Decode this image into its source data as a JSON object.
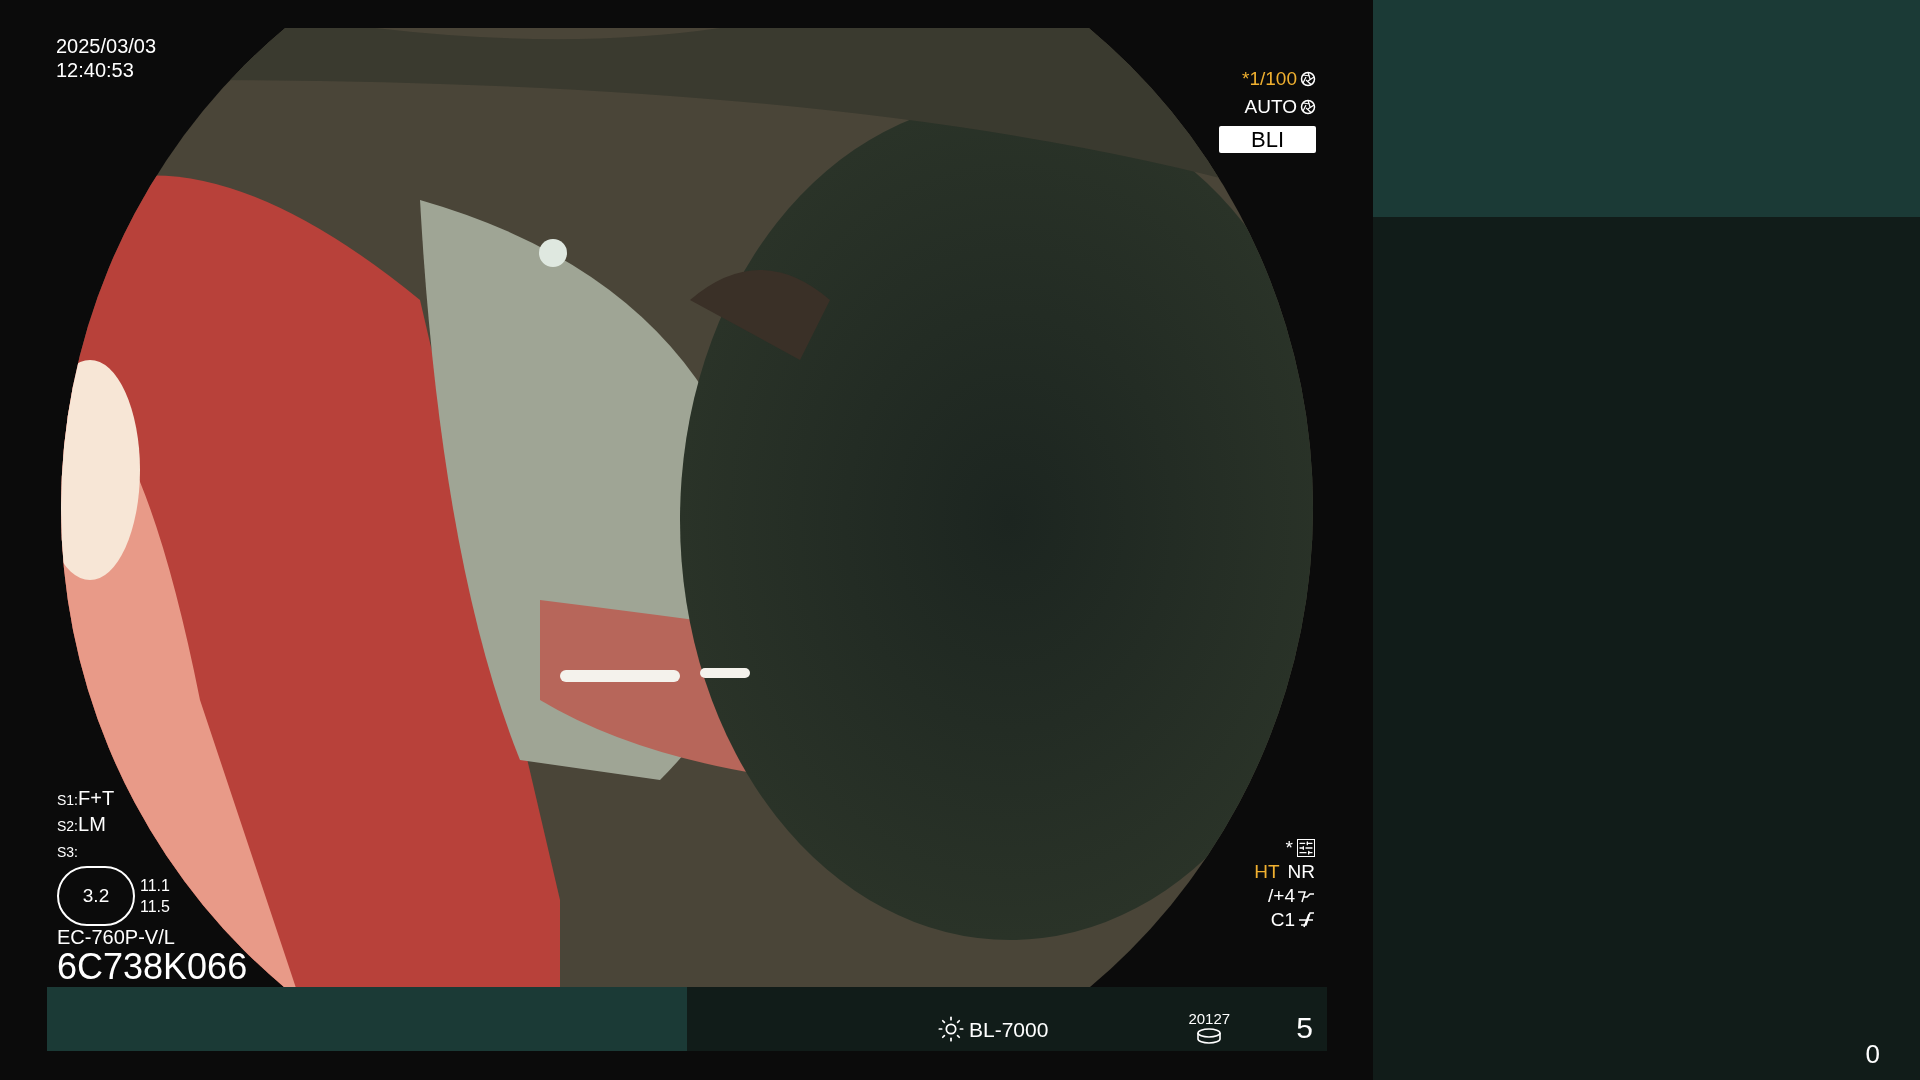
{
  "timestamp": {
    "date": "2025/03/03",
    "time": "12:40:53"
  },
  "exposure": {
    "shutter": "*1/100",
    "mode": "AUTO"
  },
  "mode_badge": "BLI",
  "settings": [
    {
      "label": "S1:",
      "value": "F+T"
    },
    {
      "label": "S2:",
      "value": "LM"
    },
    {
      "label": "S3:"
    }
  ],
  "scope_gauge": {
    "value": "3.2",
    "readings": [
      "11.1",
      "11.5"
    ]
  },
  "scope_model": "EC-760P-V/L",
  "serial": "6C738K066",
  "image_settings": {
    "star": "*",
    "ht": "HT",
    "nr": "NR",
    "enhance": "/+4",
    "color_mode": "C1"
  },
  "bottom_bar": {
    "light_source": "BL-7000",
    "counter": "20127",
    "number": "5"
  },
  "side_panel": {
    "count": "0"
  }
}
